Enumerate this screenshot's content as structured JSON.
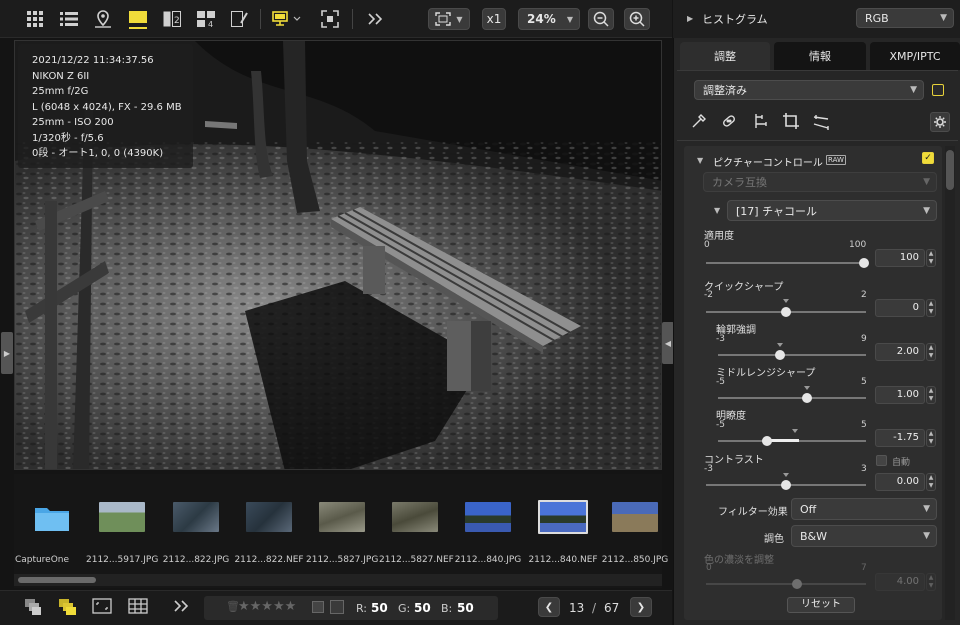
{
  "toolbar": {
    "zoom_mode": "x1",
    "zoom_level": "24%"
  },
  "info_overlay": {
    "lines": [
      "2021/12/22 11:34:37.56",
      "NIKON Z 6II",
      "25mm f/2G",
      "L (6048 x 4024), FX - 29.6 MB",
      "25mm - ISO 200",
      "1/320秒 - f/5.6",
      "0段 - オート1, 0, 0 (4390K)"
    ]
  },
  "filmstrip": {
    "items": [
      {
        "label": "CaptureOne",
        "kind": "folder"
      },
      {
        "label": "2112...5917.JPG",
        "kind": "color"
      },
      {
        "label": "2112...822.JPG",
        "kind": "color"
      },
      {
        "label": "2112...822.NEF",
        "kind": "color"
      },
      {
        "label": "2112...5827.JPG",
        "kind": "color"
      },
      {
        "label": "2112...5827.NEF",
        "kind": "color"
      },
      {
        "label": "2112...840.JPG",
        "kind": "blue"
      },
      {
        "label": "2112...840.NEF",
        "kind": "blue"
      },
      {
        "label": "2112...850.JPG",
        "kind": "color"
      }
    ]
  },
  "bottombar": {
    "rating_stars": "★★★★★",
    "r_label": "R:",
    "r_value": "50",
    "g_label": "G:",
    "g_value": "50",
    "b_label": "B:",
    "b_value": "50",
    "current_page": "13",
    "page_sep": "/",
    "total_pages": "67"
  },
  "right_panel": {
    "histogram_title": "ヒストグラム",
    "histogram_mode": "RGB",
    "tabs": [
      "調整",
      "情報",
      "XMP/IPTC"
    ],
    "preset": "調整済み",
    "section_title": "ピクチャーコントロール",
    "section_badge": "RAW",
    "camera_compat": "カメラ互換",
    "picture_control": "[17] チャコール",
    "sliders": {
      "apply": {
        "label": "適用度",
        "min": "0",
        "max": "100",
        "value": "100"
      },
      "quick_sharp": {
        "label": "クイックシャープ",
        "min": "-2",
        "max": "2",
        "value": "0"
      },
      "outline": {
        "label": "輪郭強調",
        "min": "-3",
        "max": "9",
        "value": "2.00"
      },
      "midrange": {
        "label": "ミドルレンジシャープ",
        "min": "-5",
        "max": "5",
        "value": "1.00"
      },
      "clarity": {
        "label": "明瞭度",
        "min": "-5",
        "max": "5",
        "value": "-1.75"
      },
      "contrast": {
        "label": "コントラスト",
        "min": "-3",
        "max": "3",
        "value": "0.00"
      },
      "tint": {
        "label": "色の濃淡を調整",
        "min": "0",
        "max": "7",
        "value": "4.00"
      }
    },
    "auto_label": "自動",
    "filter_label": "フィルター効果",
    "filter_value": "Off",
    "tone_label": "調色",
    "tone_value": "B&W",
    "reset_label": "リセット"
  },
  "colors": {
    "accent": "#f0dc3a",
    "panel_bg": "#262626"
  }
}
